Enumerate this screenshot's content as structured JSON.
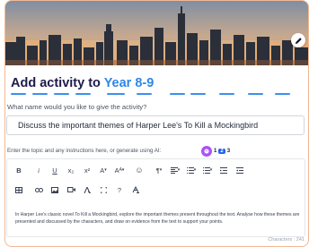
{
  "title": {
    "prefix": "Add activity to",
    "class_name": "Year 8-9"
  },
  "name_question": "What name would you like to give the activity?",
  "name_input_value": "Discuss the important themes of Harper Lee's To Kill a Mockingbird",
  "topic_prompt": "Enter the topic and any instructions here, or generate using AI:",
  "ai_counter": {
    "first": "1",
    "current": "2",
    "last": "3"
  },
  "toolbar": {
    "bold": "B",
    "italic": "i",
    "underline": "U",
    "subscript": "x₂",
    "superscript": "x²",
    "font_color": "A",
    "font_size": "A",
    "emoji": "☺",
    "paragraph": "¶",
    "help": "?"
  },
  "editor_text": "In Harper Lee's classic novel To Kill a Mockingbird, explore the important themes present throughout the text. Analyse how these themes are presented and discussed by the characters, and draw on evidence from the text to support your points.",
  "character_count": "Characters : 241",
  "colors": {
    "accent": "#2f86e6",
    "title": "#1e1b4b",
    "border": "#f2b892",
    "ai": "#a855f7"
  },
  "icons": [
    "edit-icon",
    "ai-assistant-icon",
    "table-icon",
    "link-icon",
    "image-icon",
    "video-icon",
    "clear-format-icon",
    "fullscreen-icon",
    "special-char-icon"
  ]
}
